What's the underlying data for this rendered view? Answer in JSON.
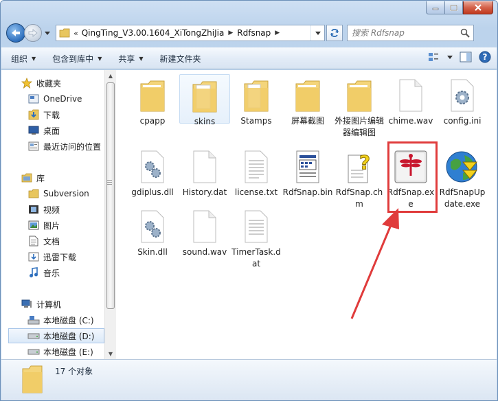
{
  "window": {
    "caption_buttons": [
      "minimize-icon",
      "maximize-icon",
      "close-icon"
    ]
  },
  "address": {
    "overflow": "«",
    "crumbs": [
      "QingTing_V3.00.1604_XiTongZhiJia",
      "Rdfsnap"
    ]
  },
  "search": {
    "placeholder": "搜索 Rdfsnap"
  },
  "toolbar": {
    "organize": "组织",
    "include": "包含到库中",
    "share": "共享",
    "new_folder": "新建文件夹"
  },
  "sidebar": {
    "favorites": "收藏夹",
    "onedrive": "OneDrive",
    "downloads": "下载",
    "desktop": "桌面",
    "recent": "最近访问的位置",
    "libraries": "库",
    "subversion": "Subversion",
    "videos": "视频",
    "pictures": "图片",
    "documents": "文档",
    "xunlei": "迅雷下载",
    "music": "音乐",
    "computer": "计算机",
    "disk_c": "本地磁盘 (C:)",
    "disk_d": "本地磁盘 (D:)",
    "disk_e": "本地磁盘 (E:)"
  },
  "files": [
    {
      "name": "cpapp",
      "icon": "folder-icon"
    },
    {
      "name": "skins",
      "icon": "folder-icon"
    },
    {
      "name": "Stamps",
      "icon": "folder-icon"
    },
    {
      "name": "屏幕截图",
      "icon": "folder-icon"
    },
    {
      "name": "外接图片编辑器编辑图",
      "icon": "folder-icon"
    },
    {
      "name": "chime.wav",
      "icon": "blank-file-icon"
    },
    {
      "name": "config.ini",
      "icon": "settings-file-icon"
    },
    {
      "name": "gdiplus.dll",
      "icon": "dll-file-icon"
    },
    {
      "name": "History.dat",
      "icon": "blank-file-icon"
    },
    {
      "name": "license.txt",
      "icon": "text-file-icon"
    },
    {
      "name": "RdfSnap.bin",
      "icon": "bin-file-icon"
    },
    {
      "name": "RdfSnap.chm",
      "icon": "help-file-icon"
    },
    {
      "name": "RdfSnap.exe",
      "icon": "dragonfly-app-icon"
    },
    {
      "name": "RdfSnapUpdate.exe",
      "icon": "update-globe-icon"
    },
    {
      "name": "Skin.dll",
      "icon": "dll-file-icon"
    },
    {
      "name": "sound.wav",
      "icon": "blank-file-icon"
    },
    {
      "name": "TimerTask.dat",
      "icon": "text-file-icon"
    }
  ],
  "details": {
    "count": "17 个对象"
  },
  "accent": {
    "highlight_red": "#e03b3b",
    "selection_blue": "#a9c7ea"
  }
}
